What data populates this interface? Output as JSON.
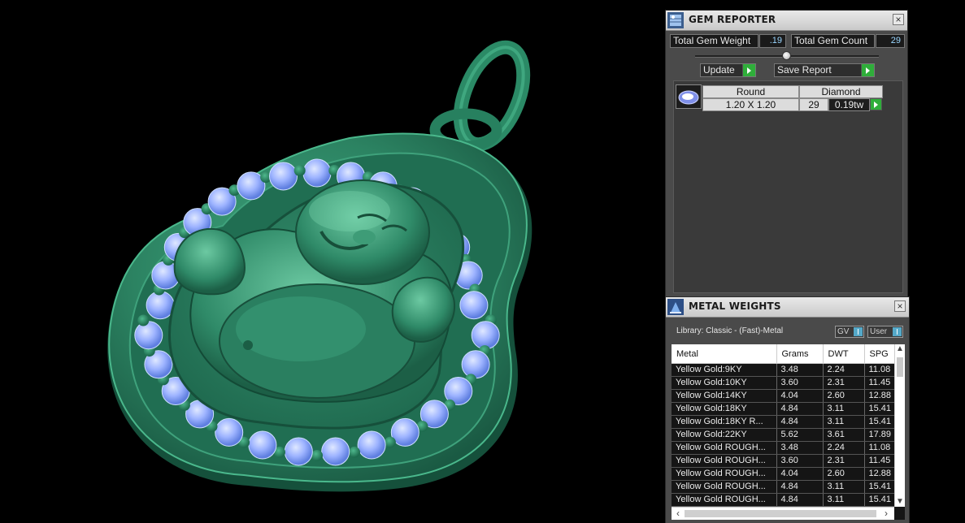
{
  "gem_reporter": {
    "title": "GEM REPORTER",
    "total_gem_weight_label": "Total Gem Weight",
    "total_gem_weight_value": ".19",
    "total_gem_count_label": "Total Gem Count",
    "total_gem_count_value": "29",
    "update_label": "Update",
    "save_report_label": "Save Report",
    "gem_row": {
      "shape": "Round",
      "material": "Diamond",
      "size": "1.20 X 1.20",
      "count": "29",
      "weight": "0.19tw"
    }
  },
  "metal_weights": {
    "title": "METAL WEIGHTS",
    "library_text": "Library: Classic - (Fast)-Metal",
    "unit_select": "GV",
    "user_select": "User",
    "columns": [
      "Metal",
      "Grams",
      "DWT",
      "SPG"
    ],
    "rows": [
      [
        "Yellow Gold:9KY",
        "3.48",
        "2.24",
        "11.08"
      ],
      [
        "Yellow Gold:10KY",
        "3.60",
        "2.31",
        "11.45"
      ],
      [
        "Yellow Gold:14KY",
        "4.04",
        "2.60",
        "12.88"
      ],
      [
        "Yellow Gold:18KY",
        "4.84",
        "3.11",
        "15.41"
      ],
      [
        "Yellow Gold:18KY R...",
        "4.84",
        "3.11",
        "15.41"
      ],
      [
        "Yellow Gold:22KY",
        "5.62",
        "3.61",
        "17.89"
      ],
      [
        "Yellow Gold ROUGH...",
        "3.48",
        "2.24",
        "11.08"
      ],
      [
        "Yellow Gold ROUGH...",
        "3.60",
        "2.31",
        "11.45"
      ],
      [
        "Yellow Gold ROUGH...",
        "4.04",
        "2.60",
        "12.88"
      ],
      [
        "Yellow Gold ROUGH...",
        "4.84",
        "3.11",
        "15.41"
      ],
      [
        "Yellow Gold ROUGH...",
        "4.84",
        "3.11",
        "15.41"
      ]
    ]
  },
  "colors": {
    "metal_green": "#2f8a68",
    "gem_blue": "#8fa9ff",
    "panel_bg": "#4a4a4a",
    "go_green": "#2fae3a"
  }
}
